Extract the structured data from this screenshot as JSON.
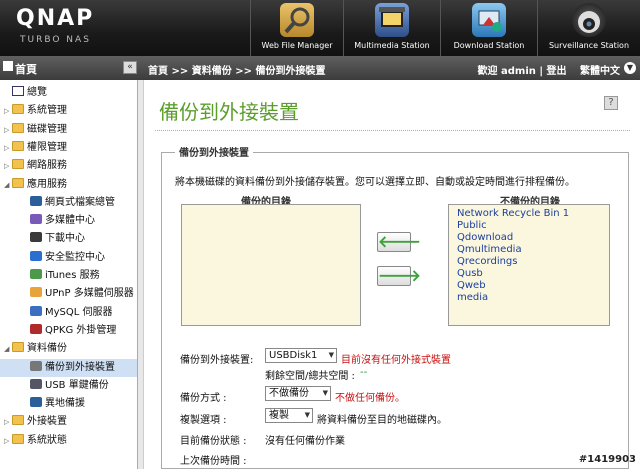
{
  "header": {
    "logo": "QNAP",
    "logo_sub": "TURBO NAS",
    "apps": [
      {
        "label": "Web File Manager",
        "icon": "file-manager-icon"
      },
      {
        "label": "Multimedia Station",
        "icon": "multimedia-icon"
      },
      {
        "label": "Download Station",
        "icon": "download-icon"
      },
      {
        "label": "Surveillance Station",
        "icon": "surveillance-icon"
      }
    ]
  },
  "toolbar": {
    "nav_title": "首頁",
    "collapse": "«",
    "breadcrumb": "首頁 >> 資料備份 >> 備份到外接裝置",
    "welcome": "歡迎 admin | 登出",
    "language": "繁體中文",
    "menu_arrow": "▼"
  },
  "sidebar": {
    "items": [
      {
        "label": "總覽",
        "indent": 0,
        "type": "page",
        "arrow": ""
      },
      {
        "label": "系統管理",
        "indent": 0,
        "type": "folder",
        "arrow": "▷"
      },
      {
        "label": "磁碟管理",
        "indent": 0,
        "type": "folder",
        "arrow": "▷"
      },
      {
        "label": "權限管理",
        "indent": 0,
        "type": "folder",
        "arrow": "▷"
      },
      {
        "label": "網路服務",
        "indent": 0,
        "type": "folder",
        "arrow": "▷"
      },
      {
        "label": "應用服務",
        "indent": 0,
        "type": "folder",
        "arrow": "◢"
      },
      {
        "label": "網頁式檔案總管",
        "indent": 1,
        "type": "app",
        "arrow": ""
      },
      {
        "label": "多媒體中心",
        "indent": 1,
        "type": "app",
        "arrow": ""
      },
      {
        "label": "下載中心",
        "indent": 1,
        "type": "app",
        "arrow": ""
      },
      {
        "label": "安全監控中心",
        "indent": 1,
        "type": "app",
        "arrow": ""
      },
      {
        "label": "iTunes 服務",
        "indent": 1,
        "type": "app",
        "arrow": ""
      },
      {
        "label": "UPnP 多媒體伺服器",
        "indent": 1,
        "type": "app",
        "arrow": ""
      },
      {
        "label": "MySQL 伺服器",
        "indent": 1,
        "type": "app",
        "arrow": ""
      },
      {
        "label": "QPKG 外掛管理",
        "indent": 1,
        "type": "app",
        "arrow": ""
      },
      {
        "label": "資料備份",
        "indent": 0,
        "type": "folder",
        "arrow": "◢"
      },
      {
        "label": "備份到外接裝置",
        "indent": 1,
        "type": "app",
        "arrow": "",
        "selected": true
      },
      {
        "label": "USB 單鍵備份",
        "indent": 1,
        "type": "app",
        "arrow": ""
      },
      {
        "label": "異地備援",
        "indent": 1,
        "type": "app",
        "arrow": ""
      },
      {
        "label": "外接裝置",
        "indent": 0,
        "type": "folder",
        "arrow": "▷"
      },
      {
        "label": "系統狀態",
        "indent": 0,
        "type": "folder",
        "arrow": "▷"
      }
    ]
  },
  "main": {
    "title": "備份到外接裝置",
    "help": "?",
    "section_title": "備份到外接裝置",
    "intro": "將本機磁碟的資料備份到外接儲存裝置。您可以選擇立即、自動或設定時間進行排程備份。",
    "left_list_title": "備份的目錄",
    "right_list_title": "不備份的目錄",
    "excluded": [
      "Network Recycle Bin 1",
      "Public",
      "Qdownload",
      "Qmultimedia",
      "Qrecordings",
      "Qusb",
      "Qweb",
      "media"
    ],
    "add_arrow": "🡐",
    "remove_arrow": "🡒",
    "device_label": "備份到外接裝置:",
    "device_value": "USBDisk1",
    "device_warning": "目前沒有任何外接式裝置",
    "space_label": "剩餘空間/總共空間 :",
    "space_value": "--",
    "method_label": "備份方式 :",
    "method_value": "不做備份",
    "method_note": "不做任何備份。",
    "copy_label": "複製選項 :",
    "copy_value": "複製",
    "copy_note": "將資料備份至目的地磁碟內。",
    "status_label": "目前備份狀態 :",
    "status_value": "沒有任何備份作業",
    "last_label": "上次備份時間 :"
  },
  "watermark": "#1419903",
  "colors": {
    "title_green": "#5b9e2c",
    "warning_red": "#c81010",
    "list_blue": "#1a3f9f",
    "list_bg": "#fbf7de"
  }
}
